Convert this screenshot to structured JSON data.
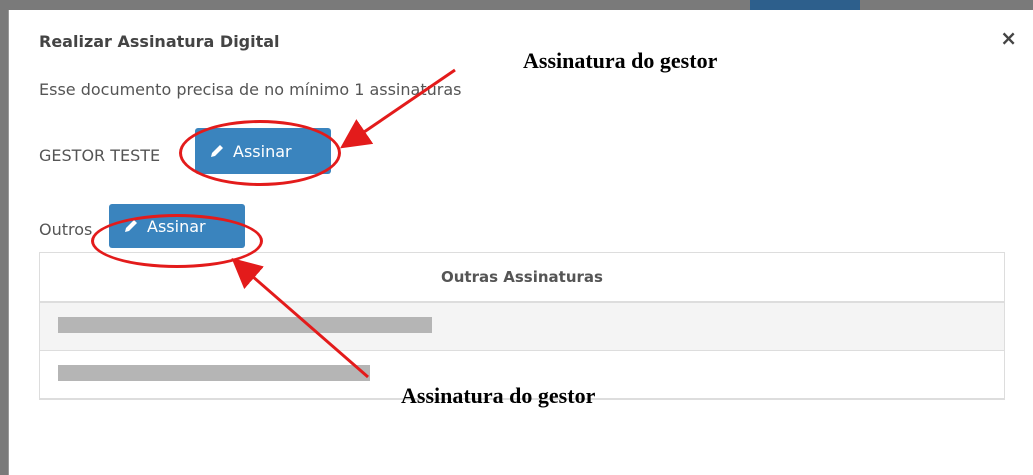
{
  "dialog": {
    "title": "Realizar Assinatura Digital",
    "info": "Esse documento precisa de no mínimo 1 assinaturas",
    "close_glyph": "×"
  },
  "gestor": {
    "label": "GESTOR TESTE",
    "button_label": "Assinar",
    "button_icon": "pencil-icon"
  },
  "outros": {
    "label": "Outros",
    "button_label": "Assinar",
    "button_icon": "pencil-icon"
  },
  "table": {
    "header": "Outras Assinaturas",
    "rows": [
      "",
      ""
    ]
  },
  "annotations": {
    "top": "Assinatura do gestor",
    "bottom": "Assinatura do gestor"
  },
  "colors": {
    "button": "#3a84be",
    "annotation": "#e31b1b"
  }
}
